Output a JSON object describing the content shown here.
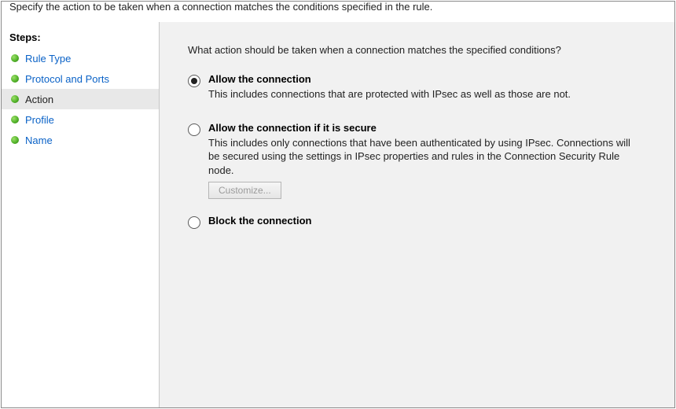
{
  "banner": "Specify the action to be taken when a connection matches the conditions specified in the rule.",
  "steps_header": "Steps:",
  "steps": [
    {
      "label": "Rule Type",
      "active": false
    },
    {
      "label": "Protocol and Ports",
      "active": false
    },
    {
      "label": "Action",
      "active": true
    },
    {
      "label": "Profile",
      "active": false
    },
    {
      "label": "Name",
      "active": false
    }
  ],
  "question": "What action should be taken when a connection matches the specified conditions?",
  "options": {
    "allow": {
      "title": "Allow the connection",
      "desc": "This includes connections that are protected with IPsec as well as those are not."
    },
    "allow_secure": {
      "title": "Allow the connection if it is secure",
      "desc": "This includes only connections that have been authenticated by using IPsec.  Connections will be secured using the settings in IPsec properties and rules in the Connection Security Rule node.",
      "customize": "Customize..."
    },
    "block": {
      "title": "Block the connection"
    }
  }
}
